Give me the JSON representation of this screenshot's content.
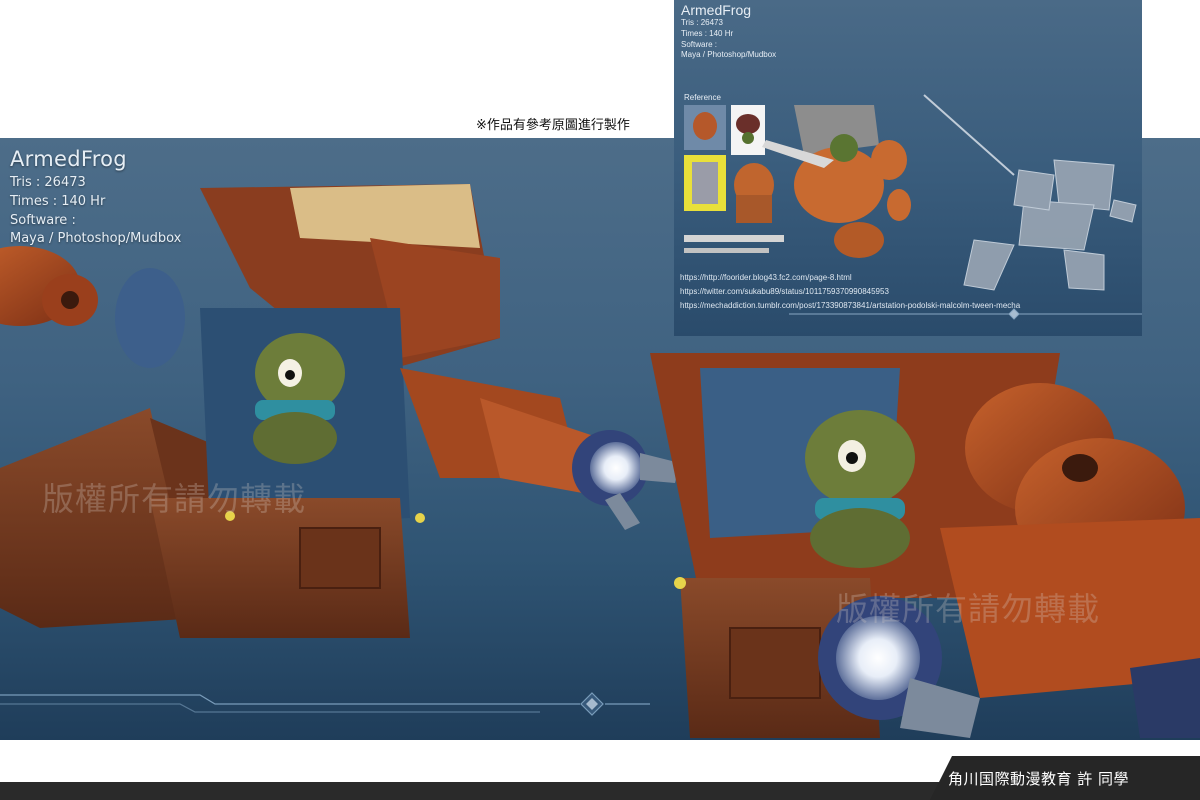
{
  "main": {
    "title": "ArmedFrog",
    "tris": "Tris : 26473",
    "times": "Times : 140 Hr",
    "software_label": "Software :",
    "software_value": "Maya / Photoshop/Mudbox",
    "watermark": "版權所有請勿轉載"
  },
  "reference_panel": {
    "title": "ArmedFrog",
    "tris": "Tris : 26473",
    "times": "Times : 140 Hr",
    "software_label": "Software :",
    "software_value": "Maya / Photoshop/Mudbox",
    "reference_label": "Reference",
    "links": [
      "https://http://foorider.blog43.fc2.com/page-8.html",
      "https://twitter.com/sukabu89/status/1011759370990845953",
      "https://mechaddiction.tumblr.com/post/173390873841/artstation-podolski-malcolm-tween-mecha"
    ]
  },
  "note": "※作品有參考原圖進行製作",
  "footer": {
    "credit": "角川国際動漫教育  許 同學"
  },
  "colors": {
    "panel_top": "#4d6d89",
    "panel_bottom": "#1f3d5a",
    "robot_orange": "#b4501f",
    "robot_wood": "#7a3f22",
    "frog_green": "#6d7d3a",
    "footer_dark": "#262626"
  }
}
